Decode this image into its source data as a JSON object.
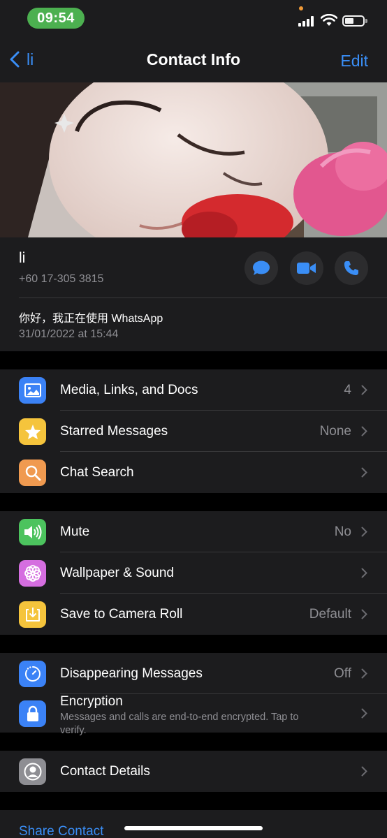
{
  "status_bar": {
    "time": "09:54",
    "signal_icon": "cellular-signal-icon",
    "wifi_icon": "wifi-icon",
    "battery_icon": "battery-icon",
    "battery_level": 0.35
  },
  "nav": {
    "back_label": "li",
    "title": "Contact Info",
    "edit_label": "Edit"
  },
  "contact": {
    "name": "li",
    "phone": "+60 17-305 3815",
    "about": "你好，我正在使用 WhatsApp",
    "about_date": "31/01/2022 at 15:44",
    "actions": [
      "message-icon",
      "video-call-icon",
      "phone-call-icon"
    ]
  },
  "group1": [
    {
      "label": "Media, Links, and Docs",
      "value": "4",
      "icon": "photo-icon",
      "color": "#3b82f6"
    },
    {
      "label": "Starred Messages",
      "value": "None",
      "icon": "star-icon",
      "color": "#f5c43c"
    },
    {
      "label": "Chat Search",
      "value": "",
      "icon": "search-icon",
      "color": "#f09a50"
    }
  ],
  "group2": [
    {
      "label": "Mute",
      "value": "No",
      "icon": "speaker-icon",
      "color": "#4cc35e"
    },
    {
      "label": "Wallpaper & Sound",
      "value": "",
      "icon": "flower-icon",
      "color": "#d56ee0"
    },
    {
      "label": "Save to Camera Roll",
      "value": "Default",
      "icon": "save-download-icon",
      "color": "#f5c43c"
    }
  ],
  "group3": {
    "disappearing": {
      "label": "Disappearing Messages",
      "value": "Off",
      "icon": "timer-icon",
      "color": "#3b82f6"
    },
    "encryption": {
      "title": "Encryption",
      "subtitle": "Messages and calls are end-to-end encrypted. Tap to verify.",
      "icon": "lock-icon",
      "color": "#3b82f6"
    }
  },
  "group4": {
    "contact_details": {
      "label": "Contact Details",
      "icon": "person-circle-icon",
      "color": "#8e8e93"
    }
  },
  "share": {
    "label": "Share Contact"
  },
  "colors": {
    "accent": "#3a8ef6",
    "background": "#000000",
    "card": "#1c1c1e"
  }
}
